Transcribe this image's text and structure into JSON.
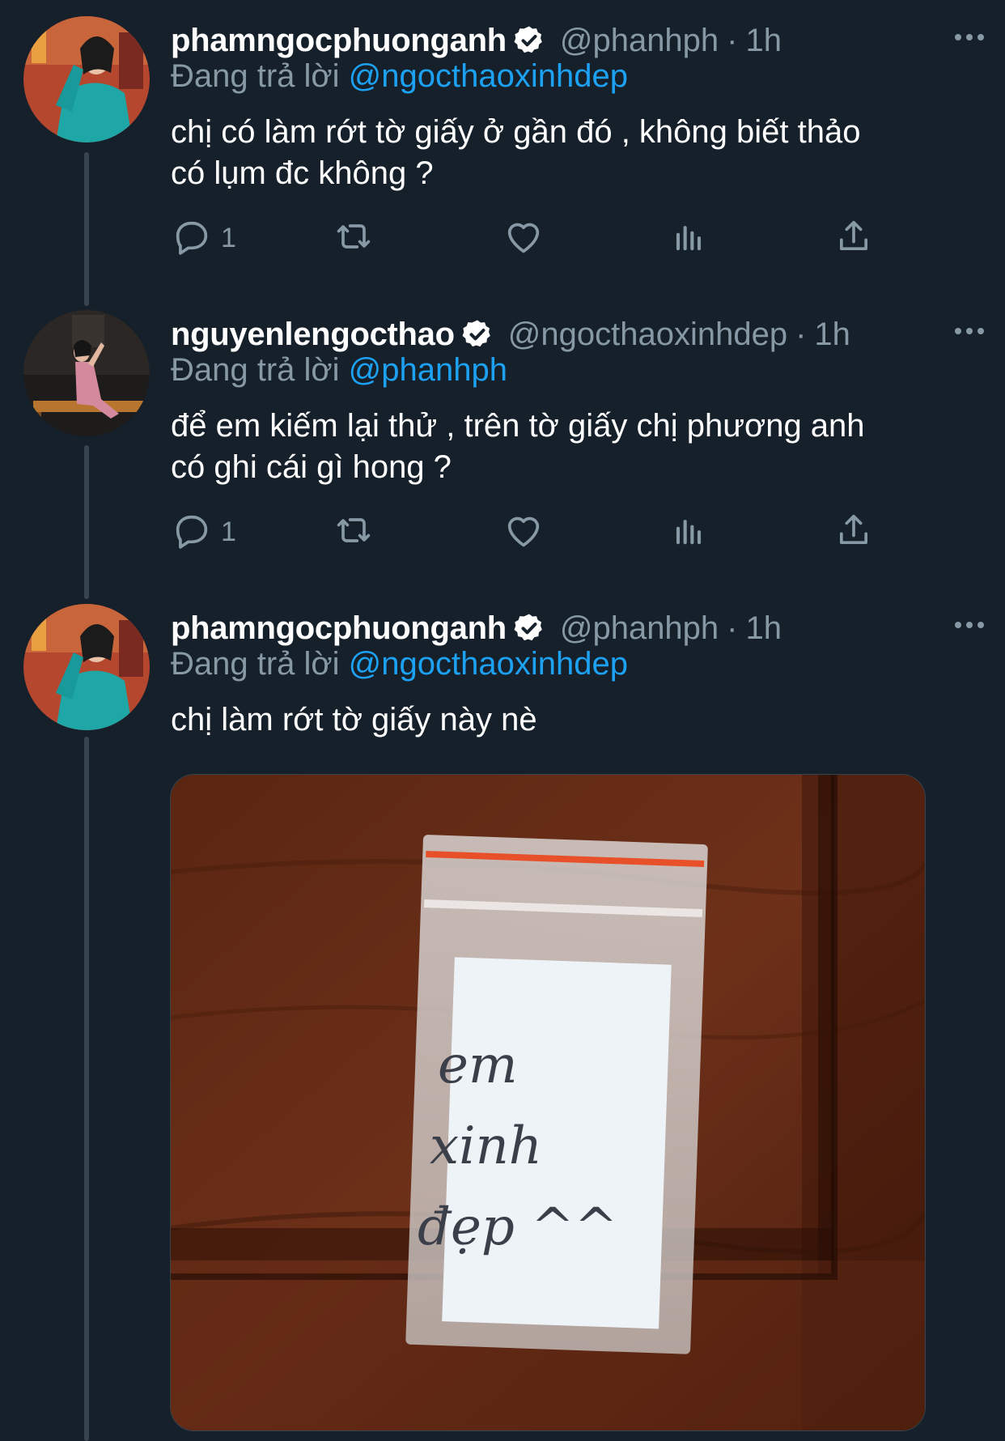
{
  "tweets": [
    {
      "display_name": "phamngocphuonganh",
      "handle": "@phanhph",
      "time": "1h",
      "replying_label": "Đang trả lời",
      "replying_to": "@ngocthaoxinhdep",
      "text": "chị có làm rớt tờ giấy ở gần đó , không biết thảo\ncó lụm đc không ?",
      "reply_count": "1"
    },
    {
      "display_name": "nguyenlengocthao",
      "handle": "@ngocthaoxinhdep",
      "time": "1h",
      "replying_label": "Đang trả lời",
      "replying_to": "@phanhph",
      "text": "để em kiếm lại thử , trên tờ giấy chị phương anh\ncó ghi cái gì hong ?",
      "reply_count": "1"
    },
    {
      "display_name": "phamngocphuonganh",
      "handle": "@phanhph",
      "time": "1h",
      "replying_label": "Đang trả lời",
      "replying_to": "@ngocthaoxinhdep",
      "text": "chị làm rớt tờ giấy này nè",
      "media": {
        "note_lines": [
          "em",
          "xinh",
          "đẹp ^^"
        ]
      }
    }
  ],
  "icons": {
    "verified": "verified-badge-icon",
    "more": "more-dots-icon",
    "reply": "reply-bubble-icon",
    "retweet": "retweet-icon",
    "like": "heart-icon",
    "analytics": "analytics-bars-icon",
    "share": "share-upload-icon"
  },
  "colors": {
    "background": "#15202b",
    "secondary_text": "#8899a6",
    "link": "#1da1f2",
    "thread_line": "#38444d"
  }
}
